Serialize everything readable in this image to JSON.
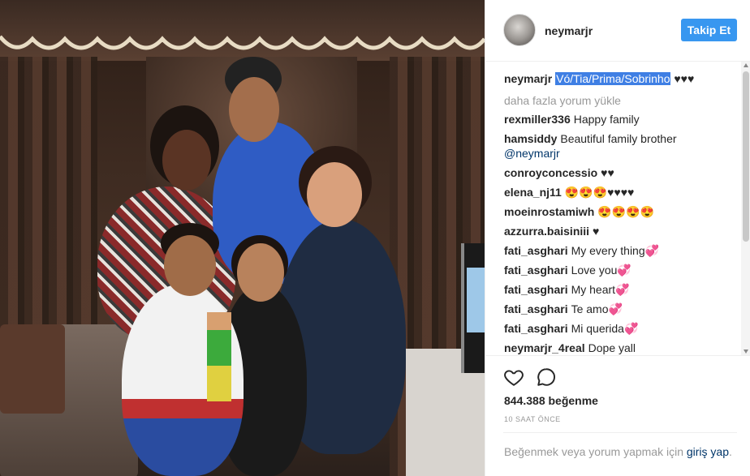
{
  "post": {
    "username": "neymarjr",
    "follow_label": "Takip Et"
  },
  "caption": {
    "username": "neymarjr",
    "highlighted_text": "Vó/Tia/Prima/Sobrinho",
    "rest": " ♥♥♥"
  },
  "load_more": "daha fazla yorum yükle",
  "comments": [
    {
      "user": "rexmiller336",
      "text": "Happy family"
    },
    {
      "user": "hamsiddy",
      "text": "Beautiful family brother",
      "mention": "@neymarjr"
    },
    {
      "user": "conroyconcessio",
      "text": "♥♥"
    },
    {
      "user": "elena_nj11",
      "text": "😍😍😍♥♥♥♥"
    },
    {
      "user": "moeinrostamiwh",
      "text": "😍😍😍😍"
    },
    {
      "user": "azzurra.baisiniii",
      "text": "♥"
    },
    {
      "user": "fati_asghari",
      "text": "My every thing💞"
    },
    {
      "user": "fati_asghari",
      "text": "Love you💞"
    },
    {
      "user": "fati_asghari",
      "text": "My heart💞"
    },
    {
      "user": "fati_asghari",
      "text": "Te amo💞"
    },
    {
      "user": "fati_asghari",
      "text": "Mi querida💞"
    },
    {
      "user": "neymarjr_4real",
      "text": "Dope yall"
    }
  ],
  "likes": "844.388 beğenme",
  "time": "10 SAAT ÖNCE",
  "login_prompt": {
    "text": "Beğenmek veya yorum yapmak için ",
    "link": "giriş yap",
    "end": "."
  },
  "colors": {
    "accent": "#3897f0",
    "link": "#003569",
    "muted": "#999999",
    "selection": "#3f7fe4"
  },
  "icons": [
    "heart-icon",
    "comment-bubble-icon"
  ]
}
